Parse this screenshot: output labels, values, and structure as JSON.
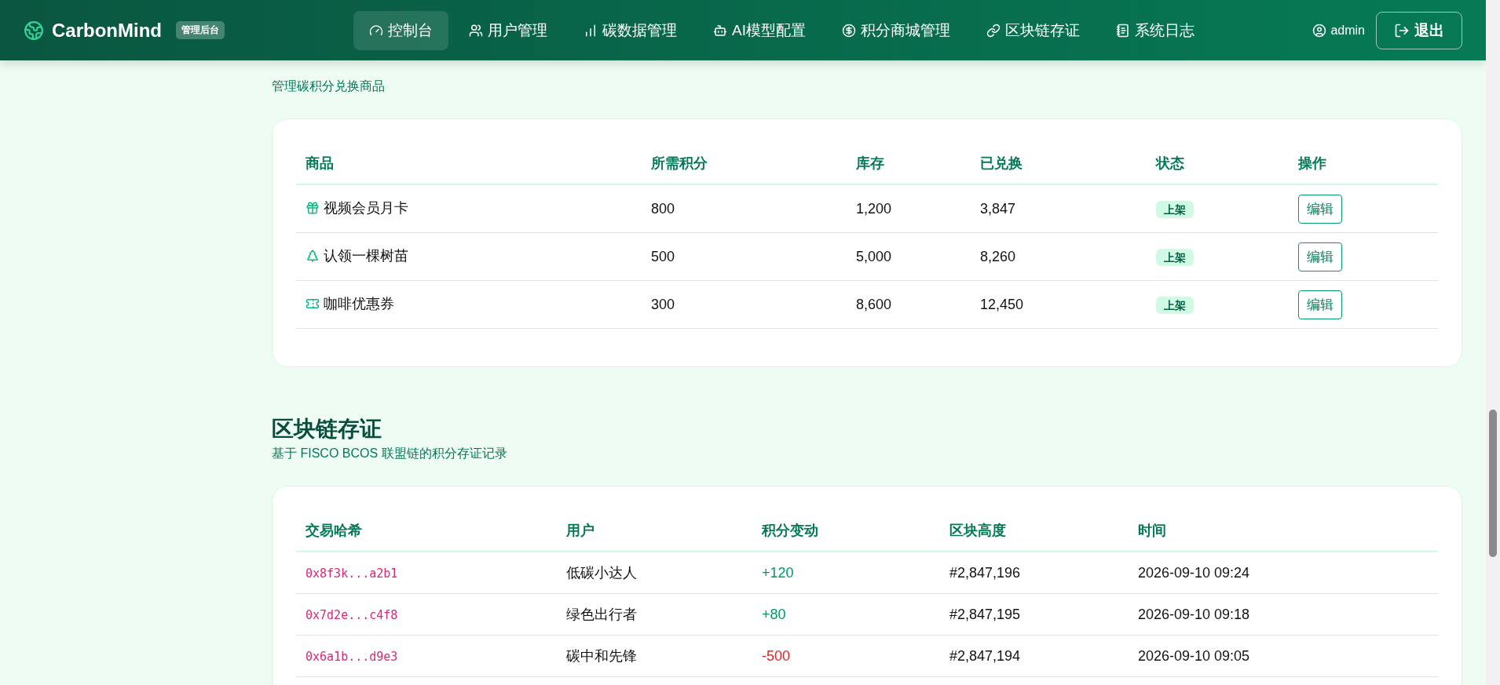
{
  "navbar": {
    "brand": "CarbonMind",
    "badge": "管理后台",
    "items": [
      {
        "label": "控制台",
        "selected": true
      },
      {
        "label": "用户管理",
        "selected": false
      },
      {
        "label": "碳数据管理",
        "selected": false
      },
      {
        "label": "AI模型配置",
        "selected": false
      },
      {
        "label": "积分商城管理",
        "selected": false
      },
      {
        "label": "区块链存证",
        "selected": false
      },
      {
        "label": "系统日志",
        "selected": false
      }
    ],
    "user": "admin",
    "logout": "退出"
  },
  "mall": {
    "subtitle": "管理碳积分兑换商品",
    "columns": [
      "商品",
      "所需积分",
      "库存",
      "已兑换",
      "状态",
      "操作"
    ],
    "rows": [
      {
        "kind": "gift",
        "name": "视频会员月卡",
        "points": "800",
        "stock": "1,200",
        "redeemed": "3,847",
        "status": "上架",
        "action": "编辑"
      },
      {
        "kind": "tree",
        "name": "认领一棵树苗",
        "points": "500",
        "stock": "5,000",
        "redeemed": "8,260",
        "status": "上架",
        "action": "编辑"
      },
      {
        "kind": "ticket",
        "name": "咖啡优惠券",
        "points": "300",
        "stock": "8,600",
        "redeemed": "12,450",
        "status": "上架",
        "action": "编辑"
      }
    ]
  },
  "chain": {
    "title": "区块链存证",
    "subtitle": "基于 FISCO BCOS 联盟链的积分存证记录",
    "columns": [
      "交易哈希",
      "用户",
      "积分变动",
      "区块高度",
      "时间"
    ],
    "rows": [
      {
        "hash": "0x8f3k...a2b1",
        "user": "低碳小达人",
        "change": "+120",
        "kind": "gain",
        "block": "#2,847,196",
        "time": "2026-09-10 09:24"
      },
      {
        "hash": "0x7d2e...c4f8",
        "user": "绿色出行者",
        "change": "+80",
        "kind": "gain",
        "block": "#2,847,195",
        "time": "2026-09-10 09:18"
      },
      {
        "hash": "0x6a1b...d9e3",
        "user": "碳中和先锋",
        "change": "-500",
        "kind": "loss",
        "block": "#2,847,194",
        "time": "2026-09-10 09:05"
      }
    ]
  }
}
